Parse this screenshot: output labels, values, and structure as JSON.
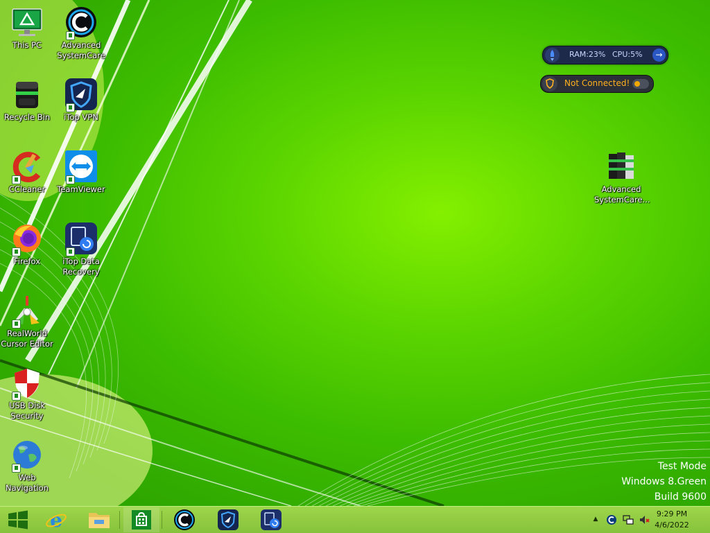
{
  "desktop": {
    "icons": [
      {
        "label": "This PC",
        "icon": "monitor-icon"
      },
      {
        "label": "Advanced SystemCare",
        "icon": "advanced-systemcare-icon"
      },
      {
        "label": "Recycle Bin",
        "icon": "recycle-bin-icon"
      },
      {
        "label": "iTop VPN",
        "icon": "itop-vpn-icon"
      },
      {
        "label": "CCleaner",
        "icon": "ccleaner-icon"
      },
      {
        "label": "TeamViewer",
        "icon": "teamviewer-icon"
      },
      {
        "label": "Firefox",
        "icon": "firefox-icon"
      },
      {
        "label": "iTop Data Recovery",
        "icon": "itop-data-recovery-icon"
      },
      {
        "label": "RealWorld Cursor Editor",
        "icon": "realworld-cursor-editor-icon"
      },
      {
        "label": "USB Disk Security",
        "icon": "usb-disk-security-icon"
      },
      {
        "label": "Web Navigation",
        "icon": "globe-icon"
      },
      {
        "label": "Advanced SystemCare...",
        "icon": "winrar-archive-icon"
      }
    ]
  },
  "widgets": {
    "ram": {
      "ram_text": "RAM:23%",
      "cpu_text": "CPU:5%",
      "arrow": "→"
    },
    "vpn": {
      "status": "Not Connected!"
    }
  },
  "watermark": {
    "line1": "Test Mode",
    "line2": "Windows 8.Green",
    "line3": "Build 9600"
  },
  "taskbar": {
    "pinned": [
      {
        "name": "start-button",
        "icon": "windows-logo-icon"
      },
      {
        "name": "internet-explorer",
        "icon": "internet-explorer-icon"
      },
      {
        "name": "file-explorer",
        "icon": "folder-icon"
      },
      {
        "name": "store",
        "icon": "store-icon"
      },
      {
        "name": "advanced-systemcare",
        "icon": "advanced-systemcare-icon"
      },
      {
        "name": "itop-vpn",
        "icon": "itop-vpn-icon"
      },
      {
        "name": "itop-data-recovery",
        "icon": "itop-data-recovery-icon"
      }
    ],
    "tray": {
      "overflow": "▲"
    },
    "clock": {
      "time": "9:29 PM",
      "date": "4/6/2022"
    }
  },
  "colors": {
    "wallpaper": "#39b800",
    "taskbar": "#9ed64a",
    "vpn_status": "#ffb020"
  }
}
